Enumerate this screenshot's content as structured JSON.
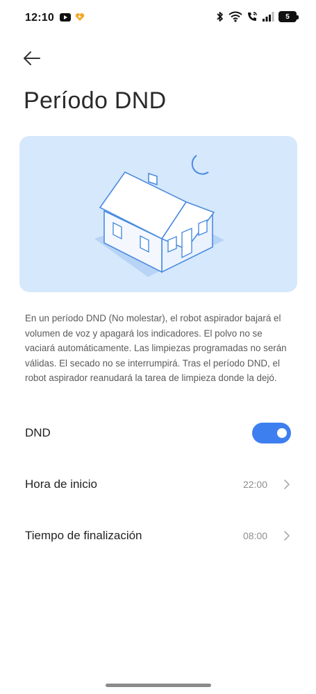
{
  "status_bar": {
    "time": "12:10",
    "battery": "5"
  },
  "page": {
    "title": "Período DND"
  },
  "illustration": {
    "icon": "house-with-moon-illustration",
    "background_color": "#d6e8fb",
    "accent_color": "#4a8be0"
  },
  "description": "En un período DND (No molestar), el robot aspirador bajará el volumen de voz y apagará los indicadores. El polvo no se vaciará automáticamente. Las limpiezas programadas no serán válidas. El secado no se interrumpirá. Tras el período DND, el robot aspirador reanudará la tarea de limpieza donde la dejó.",
  "settings": {
    "dnd": {
      "label": "DND",
      "enabled": true,
      "toggle_color": "#3e7ff0"
    },
    "start": {
      "label": "Hora de inicio",
      "value": "22:00"
    },
    "end": {
      "label": "Tiempo de finalización",
      "value": "08:00"
    }
  }
}
